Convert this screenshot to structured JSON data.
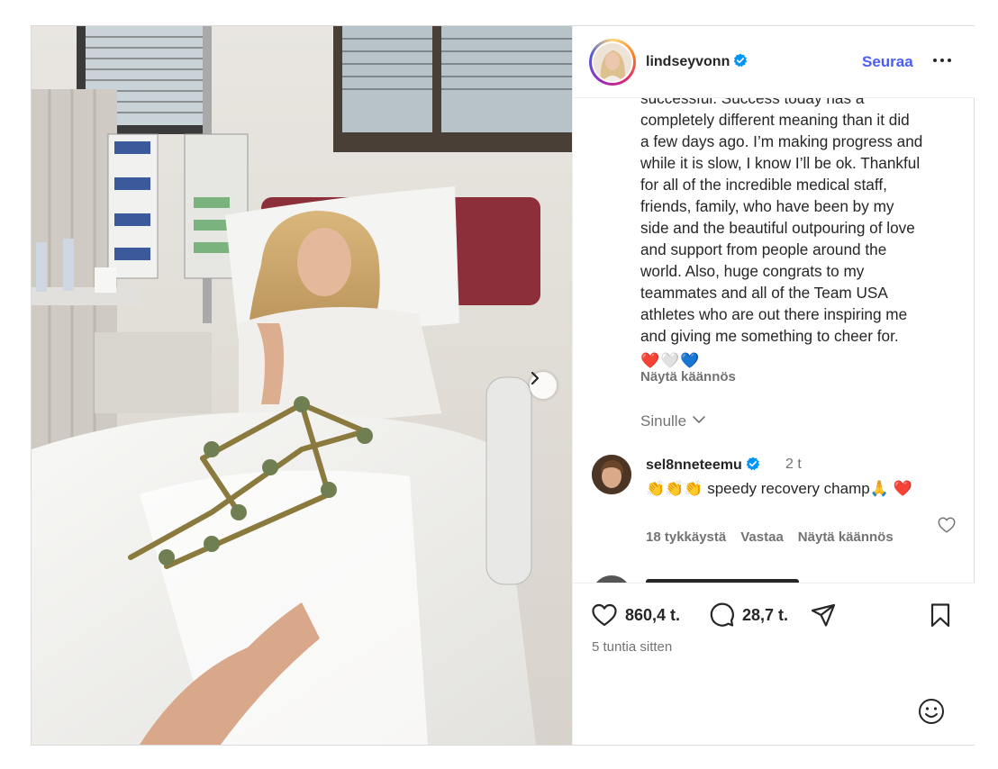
{
  "header": {
    "username": "lindseyvonn",
    "follow_label": "Seuraa"
  },
  "caption": {
    "lines": [
      "successful. Success today has a",
      "completely different meaning than it did",
      "a few days ago. I’m making progress and",
      "while it is slow, I know I’ll be ok. Thankful",
      "for all of the incredible medical staff,",
      "friends, family, who have been by my",
      "side and the beautiful outpouring of love",
      "and support from people around the",
      "world. Also, huge congrats to my",
      "teammates and all of the Team USA",
      "athletes who are out there inspiring me",
      "and giving me something to cheer for."
    ],
    "hearts": "❤️🤍💙",
    "translate_label": "Näytä käännös"
  },
  "comments_filter": {
    "label": "Sinulle"
  },
  "comment": {
    "username": "sel8nneteemu",
    "time": "2 t",
    "text": "👏👏👏 speedy recovery champ🙏 ❤️",
    "likes": "18 tykkäystä",
    "reply_label": "Vastaa",
    "translate_label": "Näytä käännös"
  },
  "actions": {
    "likes": "860,4 t.",
    "comments": "28,7 t.",
    "time_ago": "5 tuntia sitten"
  },
  "colors": {
    "link_blue": "#4a5df9",
    "verified_blue": "#0095f6",
    "secondary_text": "#737373"
  },
  "icons": [
    "heart-icon",
    "comment-icon",
    "share-icon",
    "bookmark-icon",
    "emoji-icon",
    "more-icon",
    "verified-icon",
    "chevron-right-icon",
    "chevron-down-icon"
  ]
}
